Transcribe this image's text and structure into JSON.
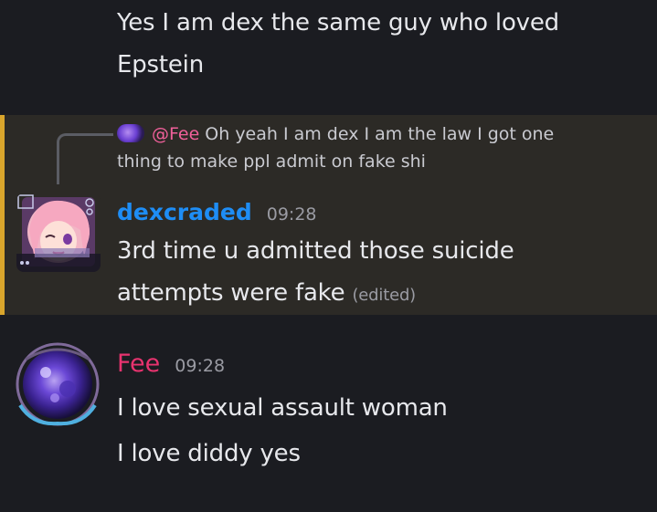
{
  "messages": [
    {
      "lines": [
        "Yes I am dex the same guy who loved",
        "Epstein"
      ]
    },
    {
      "reply": {
        "mention": "@Fee",
        "text_line1": "Oh yeah I am dex I am the law I got one",
        "text_line2": "thing to make ppl admit on fake shi"
      },
      "author": "dexcraded",
      "author_color": "#1e8df5",
      "time": "09:28",
      "lines": [
        "3rd time u admitted those suicide",
        "attempts were fake"
      ],
      "edited": "(edited)"
    },
    {
      "author": "Fee",
      "author_color": "#e8336f",
      "time": "09:28",
      "lines": [
        "I love sexual assault woman",
        "I love diddy yes"
      ]
    }
  ],
  "colors": {
    "background": "#1b1c21",
    "mention_highlight": "#2c2a26",
    "mention_bar": "#d9a52c",
    "text": "#e7e8ec",
    "muted": "#9a9ba3"
  },
  "icons": {
    "reply_avatar": "purple-galaxy-avatar",
    "avatar_dexcraded": "anime-girl-avatar",
    "avatar_fee": "purple-galaxy-avatar"
  }
}
